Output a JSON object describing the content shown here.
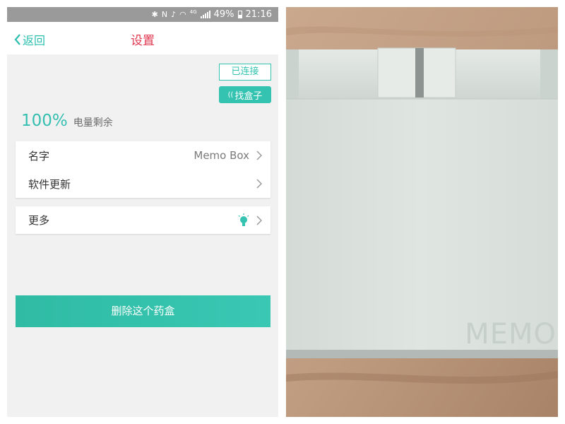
{
  "status_bar": {
    "network_type": "4G",
    "battery_percent": "49%",
    "time": "21:16",
    "icons": [
      "bluetooth-icon",
      "nfc-icon",
      "mute-icon",
      "wifi-icon",
      "signal-icon",
      "battery-icon"
    ]
  },
  "nav": {
    "back_label": "返回",
    "title": "设置"
  },
  "device": {
    "connection_label": "已连接",
    "find_box_label": "找盒子",
    "battery_percent": "100%",
    "battery_label": "电量剩余"
  },
  "settings": {
    "name_label": "名字",
    "name_value": "Memo Box",
    "update_label": "软件更新",
    "more_label": "更多"
  },
  "delete_label": "删除这个药盒",
  "photo": {
    "brand_text": "MEMO"
  },
  "colors": {
    "accent": "#33c3b0",
    "title_red": "#e0364f",
    "status_bar": "#9a9a9a",
    "page_bg": "#f1f1f1"
  }
}
